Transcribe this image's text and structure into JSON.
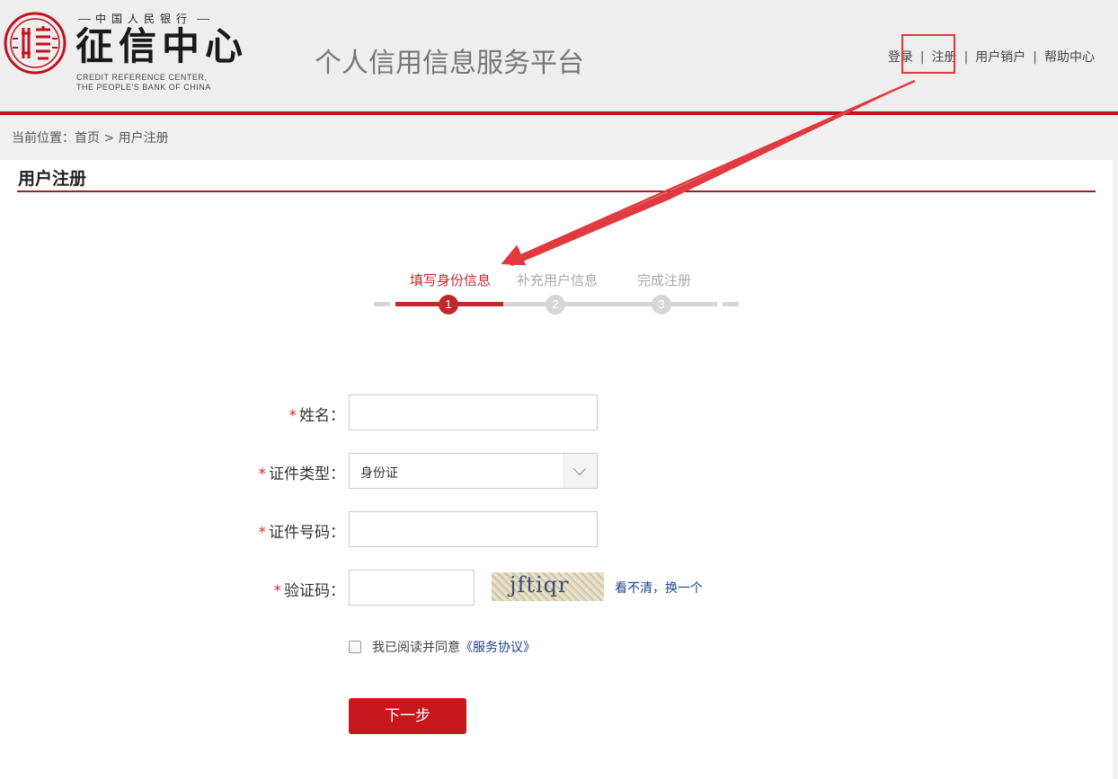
{
  "header": {
    "logo_small_text": "中国人民银行",
    "logo_big_text": "征信中心",
    "logo_en_line1": "CREDIT REFERENCE CENTER,",
    "logo_en_line2": "THE PEOPLE'S BANK OF CHINA",
    "platform_title": "个人信用信息服务平台",
    "nav": {
      "login": "登录",
      "register": "注册",
      "cancel_account": "用户销户",
      "help": "帮助中心",
      "separator": "|"
    }
  },
  "breadcrumb": "当前位置：首页 > 用户注册",
  "panel_title": "用户注册",
  "steps": [
    {
      "label": "填写身份信息",
      "number": "1",
      "state": "active"
    },
    {
      "label": "补充用户信息",
      "number": "2",
      "state": "inactive"
    },
    {
      "label": "完成注册",
      "number": "3",
      "state": "inactive"
    }
  ],
  "form": {
    "required_mark": "*",
    "name_label": "姓名：",
    "name_value": "",
    "id_type_label": "证件类型：",
    "id_type_value": "身份证",
    "id_number_label": "证件号码：",
    "id_number_value": "",
    "captcha_label": "验证码：",
    "captcha_value": "",
    "captcha_text": "jftiqr",
    "captcha_unclear": "看不清，",
    "captcha_refresh": "换一个",
    "agree_text": "我已阅读并同意",
    "agreement_link": "《服务协议》",
    "next_button": "下一步"
  },
  "colors": {
    "brand_red": "#c8161d",
    "header_bg": "#eeeeee",
    "link_blue": "#1b3f8a",
    "annotation_red": "#e0393e"
  }
}
